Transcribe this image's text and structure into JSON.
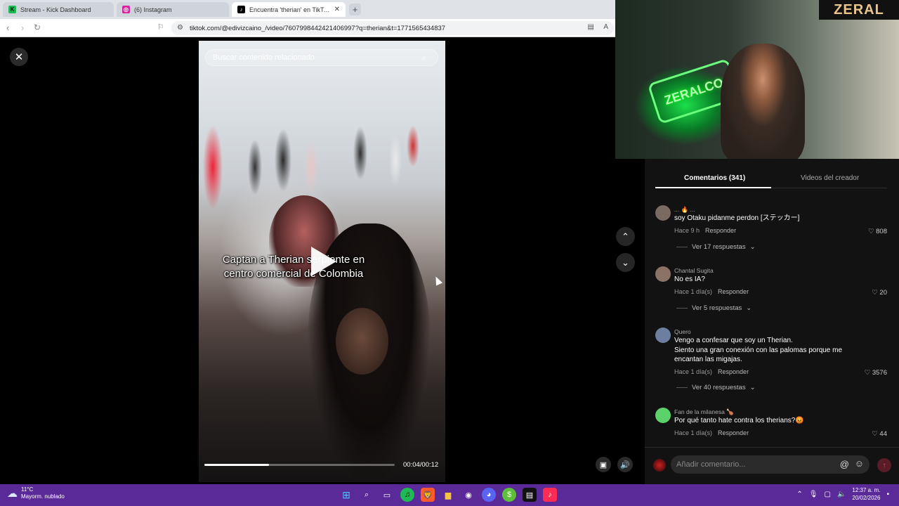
{
  "browser": {
    "tabs": [
      {
        "title": "Stream - Kick Dashboard",
        "favicon": "kick-icon",
        "color": "#1db954",
        "active": false
      },
      {
        "title": "(6) Instagram",
        "favicon": "instagram-icon",
        "color": "#d6249f",
        "active": false
      },
      {
        "title": "Encuentra 'therian' en TikTok | B",
        "favicon": "tiktok-icon",
        "color": "#000000",
        "active": true
      }
    ],
    "new_tab_label": "+",
    "url": "tiktok.com/@edivizcaino_/video/7607998442421406997?q=therian&t=1771565434837"
  },
  "video": {
    "search_placeholder": "Buscar contenido relacionado",
    "caption": "Captan a Therian serpiente en centro comercial de Colombia",
    "progress": 0.34,
    "time": "00:04/00:12"
  },
  "webcam": {
    "brand": "ZERAL",
    "neon_sign": "ZERALCO"
  },
  "comments_panel": {
    "tabs": [
      "Comentarios (341)",
      "Videos del creador"
    ],
    "comments": [
      {
        "user": "... 🔥 ...",
        "text": "soy Otaku pidanme perdon [ステッカー]",
        "time": "Hace 9 h",
        "reply": "Responder",
        "likes": "808",
        "replies": "Ver 17 respuestas",
        "avatar_color": "#7a6a62"
      },
      {
        "user": "Chantal Sugita",
        "text": "No es IA?",
        "time": "Hace 1 día(s)",
        "reply": "Responder",
        "likes": "20",
        "replies": "Ver 5 respuestas",
        "avatar_color": "#8a7266"
      },
      {
        "user": "Quero",
        "text": "Vengo a confesar que soy un Therian.\nSiento una gran conexión con las palomas porque me encantan las migajas.",
        "time": "Hace 1 día(s)",
        "reply": "Responder",
        "likes": "3576",
        "replies": "Ver 40 respuestas",
        "avatar_color": "#6d7fa0"
      },
      {
        "user": "Fan de la milanesa 🍗",
        "text": "Por qué tanto hate contra los therians?😡",
        "time": "Hace 1 día(s)",
        "reply": "Responder",
        "likes": "44",
        "replies": "",
        "avatar_color": "#5bd26a"
      }
    ],
    "composer_placeholder": "Añadir comentario..."
  },
  "taskbar": {
    "temperature": "11°C",
    "weather_desc": "Mayorm. nublado",
    "time": "12:37 a. m.",
    "date": "20/02/2026"
  }
}
